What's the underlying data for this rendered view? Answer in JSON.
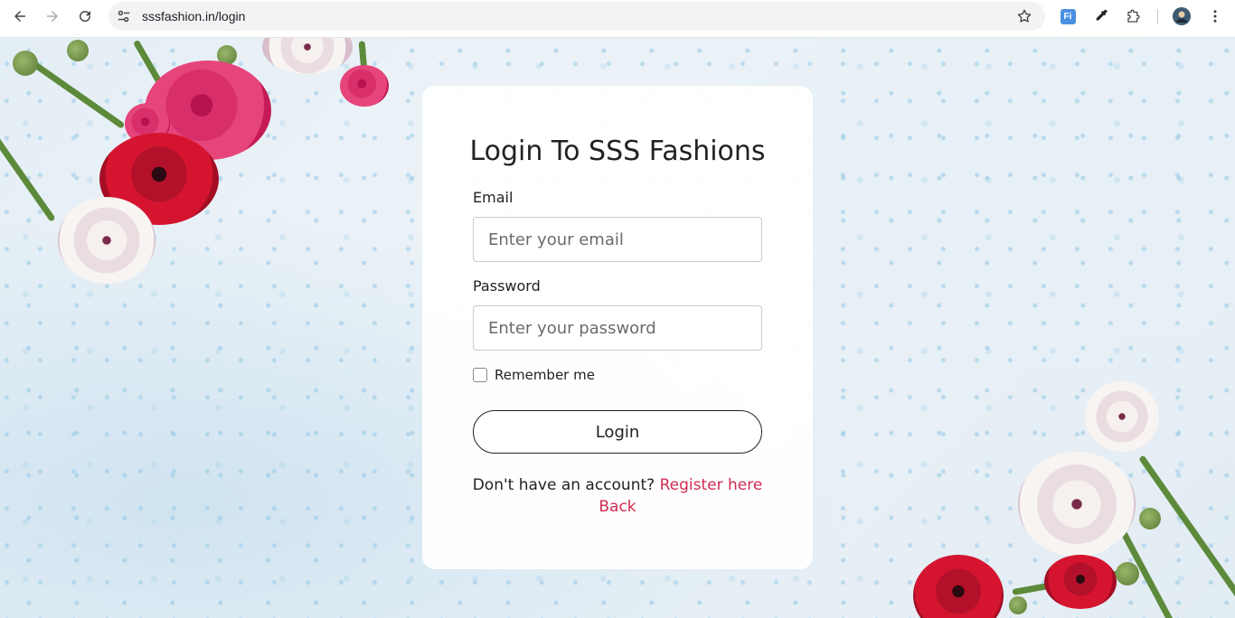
{
  "browser": {
    "url": "sssfashion.in/login",
    "icons": [
      "back-arrow-icon",
      "forward-arrow-icon",
      "reload-icon",
      "site-settings-icon",
      "bookmark-star-icon",
      "extension-fi-icon",
      "eyedropper-icon",
      "extensions-puzzle-icon",
      "profile-avatar-icon",
      "more-vert-icon"
    ],
    "extension_badge": "Fi"
  },
  "login": {
    "title": "Login To SSS Fashions",
    "email_label": "Email",
    "email_placeholder": "Enter your email",
    "email_value": "",
    "password_label": "Password",
    "password_placeholder": "Enter your password",
    "password_value": "",
    "remember_label": "Remember me",
    "remember_checked": false,
    "login_button": "Login",
    "no_account_text": "Don't have an account?",
    "register_link": "Register here",
    "back_link": "Back"
  },
  "colors": {
    "accent_link": "#d02c4f",
    "text": "#222222",
    "card_bg": "#ffffff"
  }
}
